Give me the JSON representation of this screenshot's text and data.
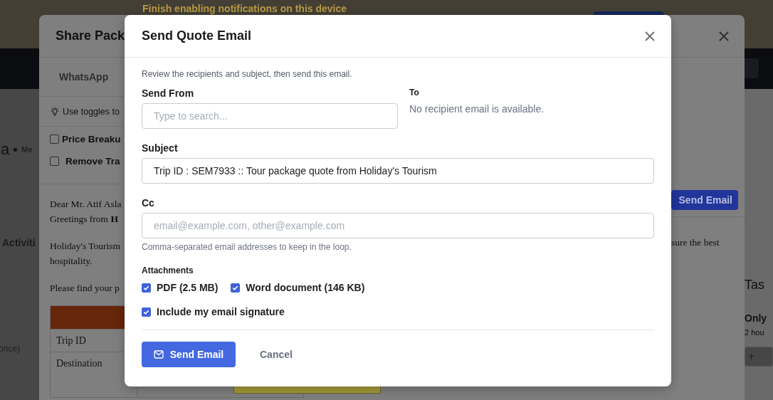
{
  "page": {
    "notification": "Finish enabling notifications on this device",
    "heading_fragment": "a",
    "meta_fragment": "Me",
    "tab_fragment": "Activiti",
    "price_fragment": "price)",
    "task_panel": {
      "title": "Tas",
      "item_title": "Only",
      "item_time": "2 hou",
      "add_button": "+"
    }
  },
  "share_dialog": {
    "title": "Share Pack",
    "tab": "WhatsApp",
    "hint": "Use toggles to",
    "options": [
      {
        "label": "Price Breaku",
        "checked": false
      },
      {
        "label": "Remove Tra",
        "checked": false
      }
    ],
    "send_button": "Send Email",
    "letter_left": [
      "Dear Mr. Atif Asla",
      "Greetings from **H**"
    ],
    "letter_paragraph_start": "Holiday's Tourism",
    "letter_paragraph_end": "sure the best",
    "letter_paragraph_last": "hospitality.",
    "letter_closing": "Please find your p",
    "table_rows": [
      "Trip ID",
      "Destination"
    ]
  },
  "send_quote": {
    "title": "Send Quote Email",
    "intro": "Review the recipients and subject, then send this email.",
    "send_from": {
      "label": "Send From",
      "placeholder": "Type to search..."
    },
    "to": {
      "label": "To",
      "message": "No recipient email is available."
    },
    "subject": {
      "label": "Subject",
      "value": "Trip ID : SEM7933 :: Tour package quote from Holiday's Tourism"
    },
    "cc": {
      "label": "Cc",
      "placeholder": "email@example.com, other@example.com",
      "help": "Comma-separated email addresses to keep in the loop."
    },
    "attachments_label": "Attachments",
    "attachments": [
      {
        "label": "PDF (2.5 MB)",
        "checked": true
      },
      {
        "label": "Word document (146 KB)",
        "checked": true
      }
    ],
    "signature": {
      "label": "Include my email signature",
      "checked": true
    },
    "send_button": "Send Email",
    "cancel_button": "Cancel"
  }
}
